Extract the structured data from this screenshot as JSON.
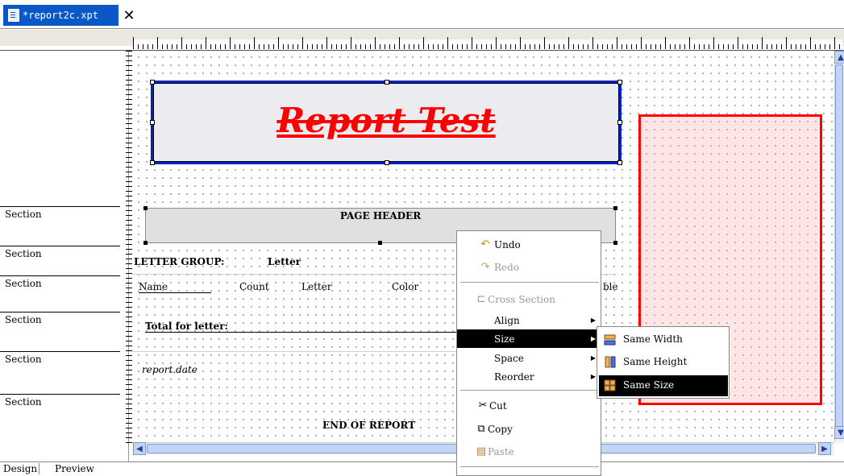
{
  "tab": {
    "title": "*report2c.xpt",
    "close": "✕"
  },
  "sections": [
    "Section",
    "Section",
    "Section",
    "Section",
    "Section",
    "Section"
  ],
  "report": {
    "title": "Report Test",
    "page_header": "PAGE HEADER",
    "letter_group": "LETTER GROUP:",
    "letter_field": "Letter",
    "col_name": "Name",
    "col_count": "Count",
    "col_letter": "Letter",
    "col_color": "Color",
    "col_partial": "ble",
    "total_label": "Total for letter:",
    "report_date": "report.date",
    "end_of_report": "END OF REPORT"
  },
  "context_menu": {
    "items": [
      {
        "label": "Undo",
        "icon": "undo-icon",
        "enabled": true
      },
      {
        "label": "Redo",
        "icon": "redo-icon",
        "enabled": false
      },
      {
        "label": "Cross Section",
        "icon": "cross-section-icon",
        "enabled": false
      },
      {
        "label": "Align",
        "submenu": true
      },
      {
        "label": "Size",
        "submenu": true,
        "selected": true
      },
      {
        "label": "Space",
        "submenu": true
      },
      {
        "label": "Reorder",
        "submenu": true
      },
      {
        "label": "Cut",
        "icon": "scissors-icon",
        "enabled": true
      },
      {
        "label": "Copy",
        "icon": "copy-icon",
        "enabled": true
      },
      {
        "label": "Paste",
        "icon": "paste-icon",
        "enabled": false
      }
    ]
  },
  "size_submenu": {
    "items": [
      {
        "label": "Same Width"
      },
      {
        "label": "Same Height"
      },
      {
        "label": "Same Size",
        "selected": true
      }
    ]
  },
  "bottom_tabs": [
    "Design",
    "Preview"
  ],
  "colors": {
    "tab_active": "#0a58c8",
    "title_border": "#0020c8",
    "title_text": "#ff0000",
    "red_box": "#ff0000"
  }
}
